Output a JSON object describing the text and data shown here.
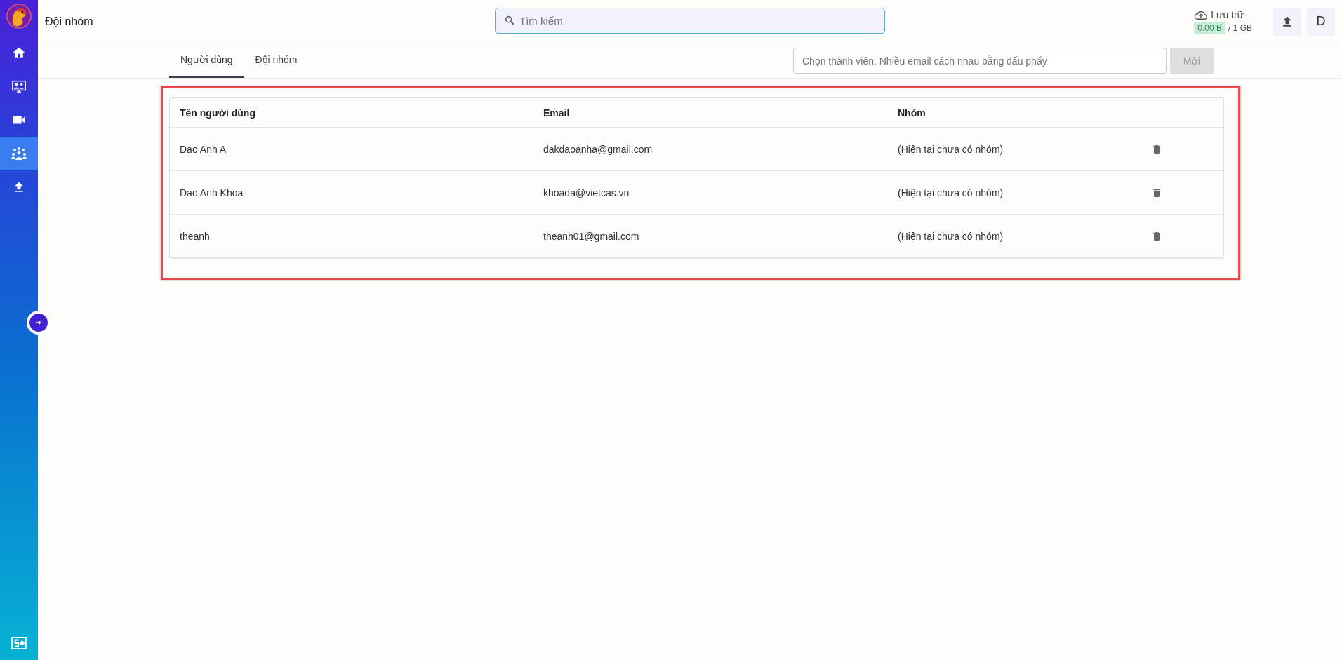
{
  "sidebar": {
    "items": [
      {
        "kind": "home",
        "selected": false
      },
      {
        "kind": "meeting",
        "selected": false
      },
      {
        "kind": "video",
        "selected": false
      },
      {
        "kind": "team",
        "selected": true
      },
      {
        "kind": "upload",
        "selected": false
      }
    ]
  },
  "header": {
    "title": "Đội nhóm",
    "search": {
      "placeholder": "Tìm kiếm"
    },
    "storage": {
      "label": "Lưu trữ",
      "used": "0.00 B",
      "total": "/ 1 GB"
    },
    "avatar": "D"
  },
  "tabs": [
    {
      "label": "Người dùng",
      "selected": true
    },
    {
      "label": "Đội nhóm",
      "selected": false
    }
  ],
  "invite": {
    "placeholder": "Chọn thành viên. Nhiều email cách nhau bằng dấu phẩy",
    "button": "Mời",
    "disabled": true
  },
  "table": {
    "columns": [
      "Tên người dùng",
      "Email",
      "Nhóm"
    ],
    "rows": [
      {
        "name": "Dao Anh A",
        "email": "dakdaoanha@gmail.com",
        "group": "(Hiện tại chưa có nhóm)"
      },
      {
        "name": "Dao Anh Khoa",
        "email": "khoada@vietcas.vn",
        "group": "(Hiện tại chưa có nhóm)"
      },
      {
        "name": "theanh",
        "email": "theanh01@gmail.com",
        "group": "(Hiện tại chưa có nhóm)"
      }
    ]
  }
}
